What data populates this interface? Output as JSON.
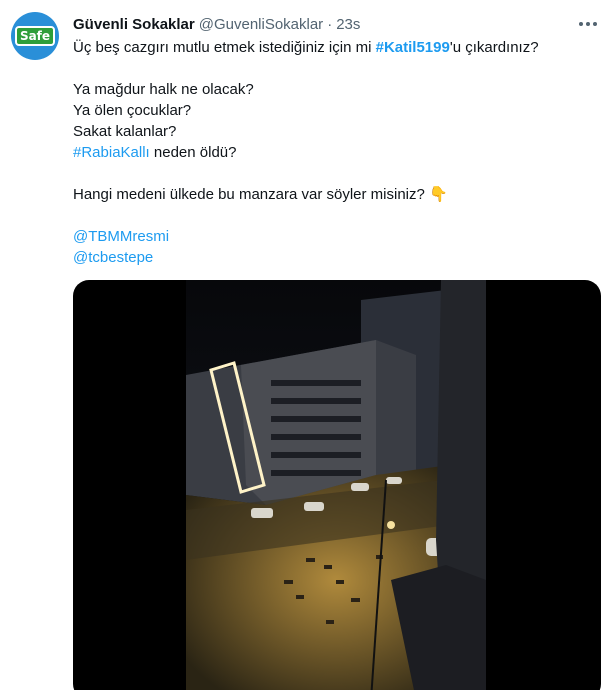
{
  "tweet": {
    "author_name": "Güvenli Sokaklar",
    "author_handle": "@GuvenliSokaklar",
    "separator": "·",
    "time": "23s",
    "avatar_label": "Safe",
    "more_icon": "ellipsis-icon",
    "text": {
      "line1_before": "Üç beş cazgırı mutlu etmek istediğiniz için mi ",
      "line1_hashtag": "#Katil5199",
      "line1_after": "'u çıkardınız?",
      "line2": "Ya mağdur halk ne olacak?",
      "line3": "Ya ölen çocuklar?",
      "line4": "Sakat kalanlar?",
      "line5_hashtag": "#RabiaKallı",
      "line5_after": " neden öldü?",
      "line6": "Hangi medeni ülkede bu manzara var söyler misiniz?",
      "line6_emoji": "👇",
      "mention1": "@TBMMresmi",
      "mention2": "@tcbestepe"
    },
    "media": {
      "type": "video",
      "icon": "night-street-video"
    }
  },
  "colors": {
    "link": "#1d9bf0",
    "secondary_text": "#536471",
    "primary_text": "#0f1419",
    "media_background": "#000000"
  }
}
